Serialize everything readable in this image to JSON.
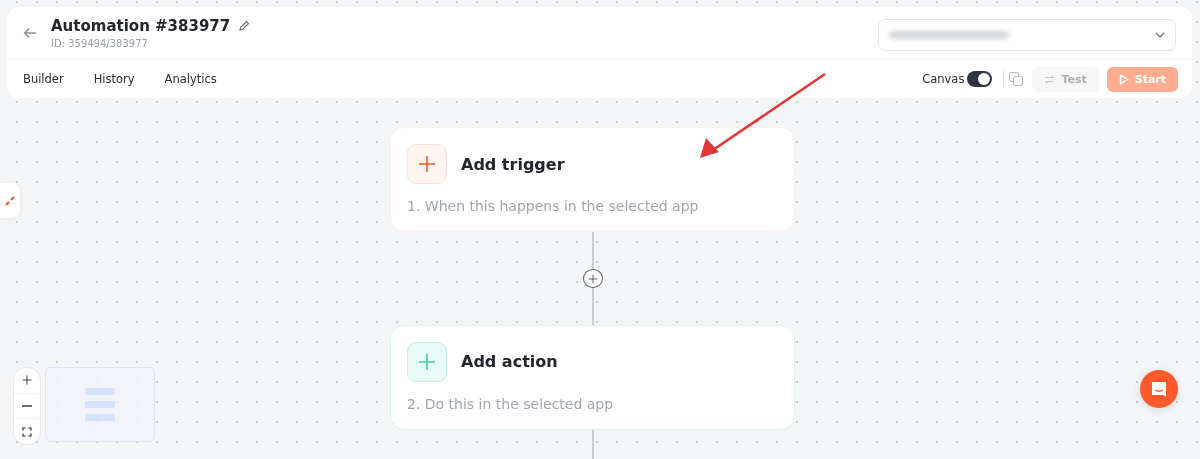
{
  "header": {
    "title": "Automation #383977",
    "id_text": "ID: 359494/383977",
    "tabs": [
      {
        "label": "Builder"
      },
      {
        "label": "History"
      },
      {
        "label": "Analytics"
      }
    ],
    "canvas_toggle": {
      "label": "Canvas",
      "on": true
    },
    "buttons": [
      {
        "kind": "test",
        "label": "Test",
        "disabled": true
      },
      {
        "kind": "start",
        "label": "Start",
        "disabled": true
      }
    ]
  },
  "nodes": [
    {
      "kind": "trigger",
      "title": "Add trigger",
      "description": "1. When this happens in the selected app"
    },
    {
      "kind": "action",
      "title": "Add action",
      "description": "2. Do this in the selected app"
    }
  ]
}
